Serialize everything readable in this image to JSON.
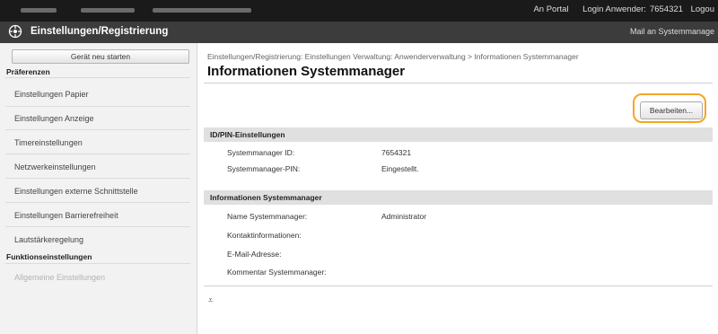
{
  "topbar": {
    "portal": "An Portal",
    "login_label": "Login Anwender:",
    "login_user": "7654321",
    "logout": "Logou"
  },
  "titlebar": {
    "title": "Einstellungen/Registrierung",
    "mail": "Mail an Systemmanage"
  },
  "sidebar": {
    "restart_label": "Gerät neu starten",
    "section_preferences": "Präferenzen",
    "items": [
      "Einstellungen Papier",
      "Einstellungen Anzeige",
      "Timereinstellungen",
      "Netzwerkeinstellungen",
      "Einstellungen externe Schnittstelle",
      "Einstellungen Barrierefreiheit",
      "Lautstärkeregelung"
    ],
    "section_functions": "Funktionseinstellungen",
    "faded_item": "Allgemeine Einstellungen"
  },
  "main": {
    "breadcrumb": "Einstellungen/Registrierung: Einstellungen Verwaltung: Anwenderverwaltung > Informationen Systemmanager",
    "page_title": "Informationen Systemmanager",
    "edit_button": "Bearbeiten...",
    "group1": {
      "heading": "ID/PIN-Einstellungen",
      "rows": [
        {
          "label": "Systemmanager ID:",
          "value": "7654321"
        },
        {
          "label": "Systemmanager-PIN:",
          "value": "Eingestellt."
        }
      ]
    },
    "group2": {
      "heading": "Informationen Systemmanager",
      "rows": [
        {
          "label": "Name Systemmanager:",
          "value": "Administrator"
        },
        {
          "label": "Kontaktinformationen:",
          "value": ""
        },
        {
          "label": "E-Mail-Adresse:",
          "value": ""
        },
        {
          "label": "Kommentar Systemmanager:",
          "value": ""
        }
      ]
    },
    "top_icon": "⩡"
  },
  "colors": {
    "topbar": "#1a1a1a",
    "titlebar": "#3c3c3c",
    "highlight_ring": "#f5a623",
    "sidebar_bg": "#f2f2f2"
  }
}
